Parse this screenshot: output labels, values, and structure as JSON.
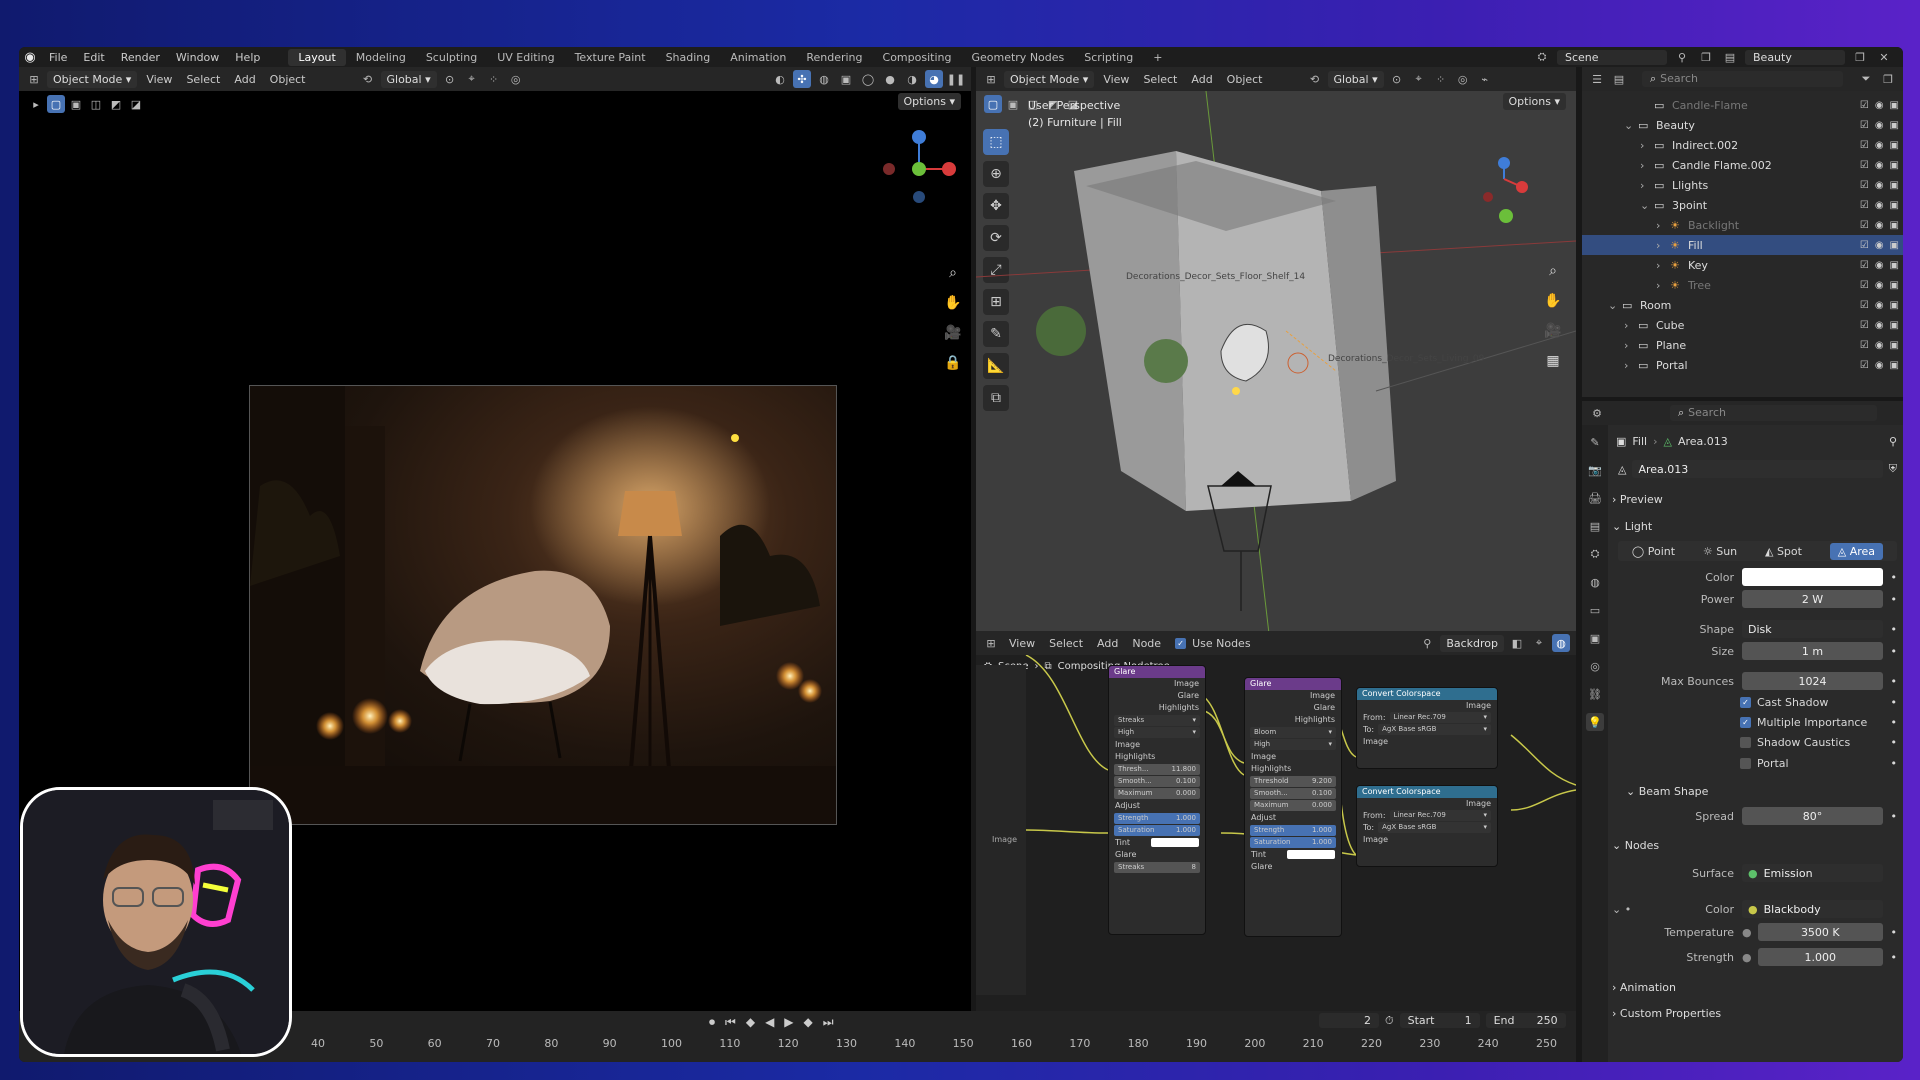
{
  "menubar": {
    "items": [
      "File",
      "Edit",
      "Render",
      "Window",
      "Help"
    ],
    "workspaces": [
      "Layout",
      "Modeling",
      "Sculpting",
      "UV Editing",
      "Texture Paint",
      "Shading",
      "Animation",
      "Rendering",
      "Compositing",
      "Geometry Nodes",
      "Scripting"
    ],
    "active_workspace": "Layout",
    "add_tab": "+",
    "scene_label": "Scene",
    "view_layer": "Beauty"
  },
  "left_viewport": {
    "mode": "Object Mode",
    "menus": [
      "View",
      "Select",
      "Add",
      "Object"
    ],
    "orientation": "Global",
    "options": "Options"
  },
  "right_viewport": {
    "mode": "Object Mode",
    "menus": [
      "View",
      "Select",
      "Add",
      "Object"
    ],
    "orientation": "Global",
    "options": "Options",
    "overlay_title": "User Perspective",
    "overlay_sub": "(2) Furniture | Fill",
    "label1": "Decorations_Decor_Sets_Floor_Shelf_14",
    "label2": "Decorations_Decor_Sets_Living_09"
  },
  "node_editor": {
    "menus": [
      "View",
      "Select",
      "Add",
      "Node"
    ],
    "use_nodes": "Use Nodes",
    "backdrop": "Backdrop",
    "breadcrumb_scene": "Scene",
    "breadcrumb_tree": "Compositing Nodetree",
    "side_image": "Image",
    "glare1": {
      "title": "Glare",
      "outputs": [
        "Image",
        "Glare",
        "Highlights"
      ],
      "type": "Streaks",
      "quality": "High",
      "in_image": "Image",
      "sec_highlights": "Highlights",
      "threshold": "Thresh...",
      "threshold_val": "11.800",
      "smooth": "Smooth...",
      "smooth_val": "0.100",
      "maximum": "Maximum",
      "maximum_val": "0.000",
      "sec_adjust": "Adjust",
      "strength": "Strength",
      "strength_val": "1.000",
      "saturation": "Saturation",
      "saturation_val": "1.000",
      "tint": "Tint",
      "sec_glare": "Glare",
      "streaks": "Streaks",
      "streaks_val": "8"
    },
    "glare2": {
      "title": "Glare",
      "outputs": [
        "Image",
        "Glare",
        "Highlights"
      ],
      "type": "Bloom",
      "quality": "High",
      "in_image": "Image",
      "sec_highlights": "Highlights",
      "threshold": "Threshold",
      "threshold_val": "9.200",
      "smooth": "Smooth...",
      "smooth_val": "0.100",
      "maximum": "Maximum",
      "maximum_val": "0.000",
      "sec_adjust": "Adjust",
      "strength": "Strength",
      "strength_val": "1.000",
      "saturation": "Saturation",
      "saturation_val": "1.000",
      "tint": "Tint",
      "sec_glare": "Glare"
    },
    "cc1": {
      "title": "Convert Colorspace",
      "out": "Image",
      "from_label": "From:",
      "from": "Linear Rec.709",
      "to_label": "To:",
      "to": "AgX Base sRGB",
      "in": "Image"
    },
    "cc2": {
      "title": "Convert Colorspace",
      "out": "Image",
      "from_label": "From:",
      "from": "Linear Rec.709",
      "to_label": "To:",
      "to": "AgX Base sRGB",
      "in": "Image"
    }
  },
  "outliner": {
    "search": "Search",
    "rows": [
      {
        "label": "Candle-Flame",
        "indent": 3,
        "dim": true,
        "arrow": ""
      },
      {
        "label": "Beauty",
        "indent": 2,
        "arrow": "⌄"
      },
      {
        "label": "Indirect.002",
        "indent": 3,
        "arrow": "›"
      },
      {
        "label": "Candle Flame.002",
        "indent": 3,
        "arrow": "›"
      },
      {
        "label": "Llights",
        "indent": 3,
        "arrow": "›"
      },
      {
        "label": "3point",
        "indent": 3,
        "arrow": "⌄"
      },
      {
        "label": "Backlight",
        "indent": 4,
        "dim": true,
        "arrow": "›"
      },
      {
        "label": "Fill",
        "indent": 4,
        "sel": true,
        "arrow": "›"
      },
      {
        "label": "Key",
        "indent": 4,
        "arrow": "›"
      },
      {
        "label": "Tree",
        "indent": 4,
        "dim": true,
        "arrow": "›"
      },
      {
        "label": "Room",
        "indent": 1,
        "arrow": "⌄"
      },
      {
        "label": "Cube",
        "indent": 2,
        "arrow": "›"
      },
      {
        "label": "Plane",
        "indent": 2,
        "arrow": "›"
      },
      {
        "label": "Portal",
        "indent": 2,
        "arrow": "›"
      }
    ]
  },
  "properties": {
    "search": "Search",
    "breadcrumb_obj": "Fill",
    "breadcrumb_data": "Area.013",
    "datablock": "Area.013",
    "sec_preview": "Preview",
    "sec_light": "Light",
    "light_types": [
      "Point",
      "Sun",
      "Spot",
      "Area"
    ],
    "active_type": "Area",
    "color_label": "Color",
    "power_label": "Power",
    "power": "2 W",
    "shape_label": "Shape",
    "shape": "Disk",
    "size_label": "Size",
    "size": "1 m",
    "bounces_label": "Max Bounces",
    "bounces": "1024",
    "cast_shadow": "Cast Shadow",
    "multiple_importance": "Multiple Importance",
    "shadow_caustics": "Shadow Caustics",
    "portal": "Portal",
    "sec_beam": "Beam Shape",
    "spread_label": "Spread",
    "spread": "80°",
    "sec_nodes": "Nodes",
    "surface_label": "Surface",
    "surface": "Emission",
    "ncolor_label": "Color",
    "ncolor": "Blackbody",
    "temp_label": "Temperature",
    "temp": "3500 K",
    "strength_label": "Strength",
    "strength": "1.000",
    "sec_animation": "Animation",
    "sec_custom": "Custom Properties"
  },
  "timeline": {
    "current_frame": "2",
    "start_label": "Start",
    "start": "1",
    "end_label": "End",
    "end": "250",
    "ticks": [
      "40",
      "50",
      "60",
      "70",
      "80",
      "90",
      "100",
      "110",
      "120",
      "130",
      "140",
      "150",
      "160",
      "170",
      "180",
      "190",
      "200",
      "210",
      "220",
      "230",
      "240",
      "250"
    ]
  },
  "colors": {
    "accent": "#4772b3",
    "selected": "#334d80",
    "header": "#262626",
    "light_icon": "#e8a040",
    "data_icon": "#5dc06a"
  }
}
